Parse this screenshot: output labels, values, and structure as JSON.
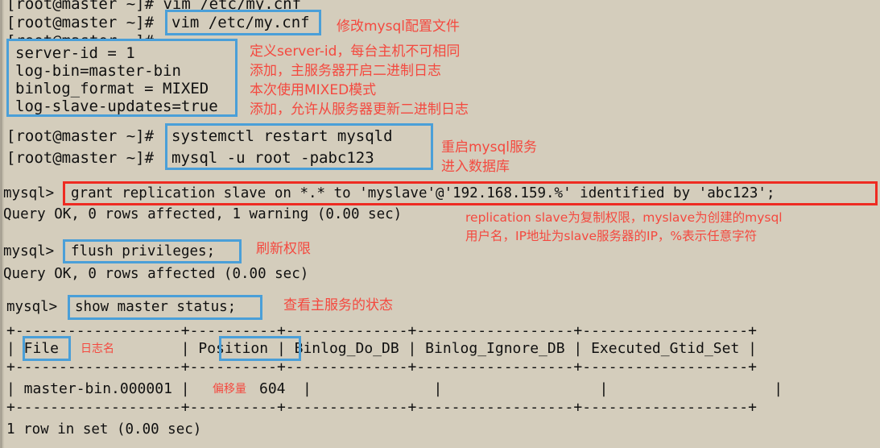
{
  "terminal": {
    "background_color": "#d4cdbc",
    "text_color": "#101010",
    "highlight_blue": "#4a9fd8",
    "highlight_red": "#ee2b22",
    "annotation_color": "#f4493f",
    "prompt_shell": "[root@master ~]#",
    "prompt_mysql": "mysql>"
  },
  "lines": {
    "l0_partial": "[root@master ~]# vim /etc/my.cnf",
    "l1_prompt": "[root@master ~]#",
    "l1_cmd": "vim /etc/my.cnf",
    "l2_prompt_ghost": "[root@master ~]#",
    "l3_prompt": "[root@master ~]#",
    "l3_cmd": "systemctl restart mysqld",
    "l4_prompt": "[root@master ~]#",
    "l4_cmd": "mysql -u root -pabc123",
    "l5_prompt": "mysql>",
    "l5_cmd": "grant replication slave on *.* to 'myslave'@'192.168.159.%' identified by 'abc123';",
    "l6_result": "Query OK, 0 rows affected, 1 warning (0.00 sec)",
    "l7_prompt": "mysql>",
    "l7_cmd": "flush privileges;",
    "l8_result": "Query OK, 0 rows affected (0.00 sec)",
    "l9_prompt": "mysql>",
    "l9_cmd": "show master status;",
    "l_footer": "1 row in set (0.00 sec)"
  },
  "config_block": {
    "line1": "server-id = 1",
    "line2": "log-bin=master-bin",
    "line3": "binlog_format = MIXED",
    "line4": "log-slave-updates=true"
  },
  "annotations": {
    "a1": "修改mysql配置文件",
    "a2": "定义server-id，每台主机不可相同",
    "a3": "添加，主服务器开启二进制日志",
    "a4": "本次使用MIXED模式",
    "a5": "添加，允许从服务器更新二进制日志",
    "a6": "重启mysql服务",
    "a7": "进入数据库",
    "a8_line1": "replication slave为复制权限，myslave为创建的mysql",
    "a8_line2": "用户名，IP地址为slave服务器的IP，%表示任意字符",
    "a9": "刷新权限",
    "a10": "查看主服务的状态",
    "a11_log_name": "日志名",
    "a12_offset": "偏移量"
  },
  "master_status_table": {
    "border_top": "+-------------------+----------+--------------+------------------+-------------------+",
    "border_mid": "+-------------------+----------+--------------+------------------+-------------------+",
    "border_bottom": "+-------------------+----------+--------------+------------------+-------------------+",
    "headers": [
      "File",
      "Position",
      "Binlog_Do_DB",
      "Binlog_Ignore_DB",
      "Executed_Gtid_Set"
    ],
    "header_row_raw": "| File              | Position | Binlog_Do_DB | Binlog_Ignore_DB | Executed_Gtid_Set |",
    "rows": [
      {
        "File": "master-bin.000001",
        "Position": "604",
        "Binlog_Do_DB": "",
        "Binlog_Ignore_DB": "",
        "Executed_Gtid_Set": ""
      }
    ],
    "data_row_prefix": "| master-bin.000001 |",
    "data_row_position_value": "604",
    "data_row_suffix": "|              |                  |                   |"
  }
}
